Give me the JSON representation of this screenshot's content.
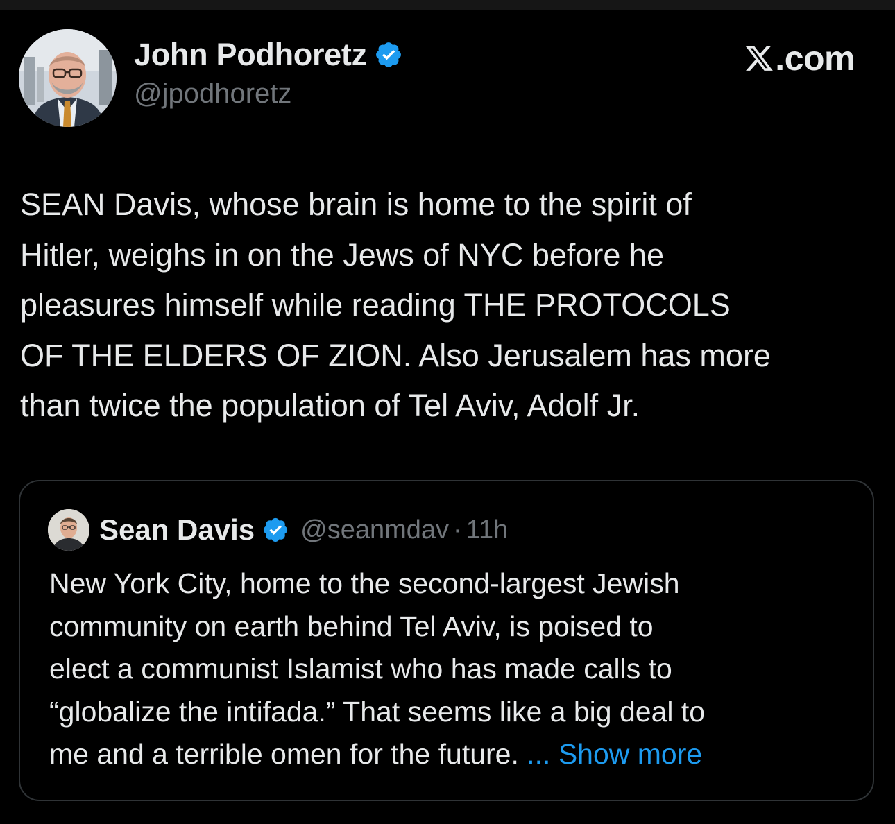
{
  "author": {
    "name": "John Podhoretz",
    "handle": "@jpodhoretz"
  },
  "brand": {
    "logo_text": ".com"
  },
  "tweet": {
    "lines": [
      "SEAN Davis, whose brain is home to the spirit of",
      "Hitler, weighs in on the Jews of NYC before he",
      "pleasures himself while reading THE PROTOCOLS",
      "OF THE ELDERS OF ZION. Also Jerusalem has more",
      "than twice the population of Tel Aviv, Adolf Jr."
    ]
  },
  "quote": {
    "name": "Sean Davis",
    "handle": "@seanmdav",
    "separator": "·",
    "time": "11h",
    "lines": [
      "New York City, home to the second-largest Jewish",
      "community on earth behind Tel Aviv, is poised to",
      "elect a communist Islamist who has made calls to",
      "“globalize the intifada.” That seems like a big deal to",
      "me and a terrible omen for the future. "
    ],
    "show_more": "... Show more"
  },
  "colors": {
    "background": "#000000",
    "text": "#e7e9ea",
    "secondary": "#71767b",
    "link": "#1d9bf0",
    "verified": "#1d9bf0",
    "border": "#2f3336"
  },
  "icons": {
    "verified": "verified-badge-icon",
    "x_logo": "x-logo-icon"
  }
}
